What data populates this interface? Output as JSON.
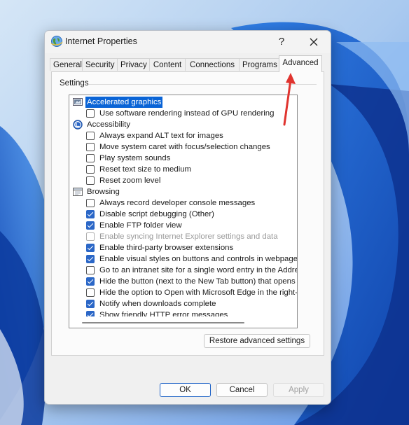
{
  "window": {
    "title": "Internet Properties",
    "help_glyph": "?",
    "close_label": "Close"
  },
  "tabs": [
    {
      "label": "General",
      "active": false
    },
    {
      "label": "Security",
      "active": false
    },
    {
      "label": "Privacy",
      "active": false
    },
    {
      "label": "Content",
      "active": false
    },
    {
      "label": "Connections",
      "active": false
    },
    {
      "label": "Programs",
      "active": false
    },
    {
      "label": "Advanced",
      "active": true
    }
  ],
  "panel": {
    "settings_label": "Settings",
    "rows": [
      {
        "kind": "category",
        "icon": "display-icon",
        "label": "Accelerated graphics",
        "selected": true
      },
      {
        "kind": "option",
        "label": "Use software rendering instead of GPU rendering",
        "checked": false,
        "disabled": false
      },
      {
        "kind": "category",
        "icon": "accessibility-icon",
        "label": "Accessibility",
        "selected": false
      },
      {
        "kind": "option",
        "label": "Always expand ALT text for images",
        "checked": false,
        "disabled": false
      },
      {
        "kind": "option",
        "label": "Move system caret with focus/selection changes",
        "checked": false,
        "disabled": false
      },
      {
        "kind": "option",
        "label": "Play system sounds",
        "checked": false,
        "disabled": false
      },
      {
        "kind": "option",
        "label": "Reset text size to medium",
        "checked": false,
        "disabled": false
      },
      {
        "kind": "option",
        "label": "Reset zoom level",
        "checked": false,
        "disabled": false
      },
      {
        "kind": "category",
        "icon": "browsing-icon",
        "label": "Browsing",
        "selected": false
      },
      {
        "kind": "option",
        "label": "Always record developer console messages",
        "checked": false,
        "disabled": false
      },
      {
        "kind": "option",
        "label": "Disable script debugging (Other)",
        "checked": true,
        "disabled": false
      },
      {
        "kind": "option",
        "label": "Enable FTP folder view",
        "checked": true,
        "disabled": false
      },
      {
        "kind": "option",
        "label": "Enable syncing Internet Explorer settings and data",
        "checked": false,
        "disabled": true
      },
      {
        "kind": "option",
        "label": "Enable third-party browser extensions",
        "checked": true,
        "disabled": false
      },
      {
        "kind": "option",
        "label": "Enable visual styles on buttons and controls in webpages",
        "checked": true,
        "disabled": false
      },
      {
        "kind": "option",
        "label": "Go to an intranet site for a single word entry in the Addres",
        "checked": false,
        "disabled": false
      },
      {
        "kind": "option",
        "label": "Hide the button (next to the New Tab button) that opens",
        "checked": true,
        "disabled": false
      },
      {
        "kind": "option",
        "label": "Hide the option to Open with Microsoft Edge in the right-cl",
        "checked": false,
        "disabled": false
      },
      {
        "kind": "option",
        "label": "Notify when downloads complete",
        "checked": true,
        "disabled": false
      },
      {
        "kind": "option",
        "label": "Show friendly HTTP error messages",
        "checked": true,
        "disabled": false
      }
    ],
    "restore_button": "Restore advanced settings"
  },
  "footer": {
    "ok": "OK",
    "cancel": "Cancel",
    "apply": "Apply"
  },
  "colors": {
    "accent": "#0a64d6",
    "checkbox_checked": "#2b67c7",
    "annotation_arrow": "#e0342f",
    "wallpaper_blue": "#1e5fd0"
  }
}
